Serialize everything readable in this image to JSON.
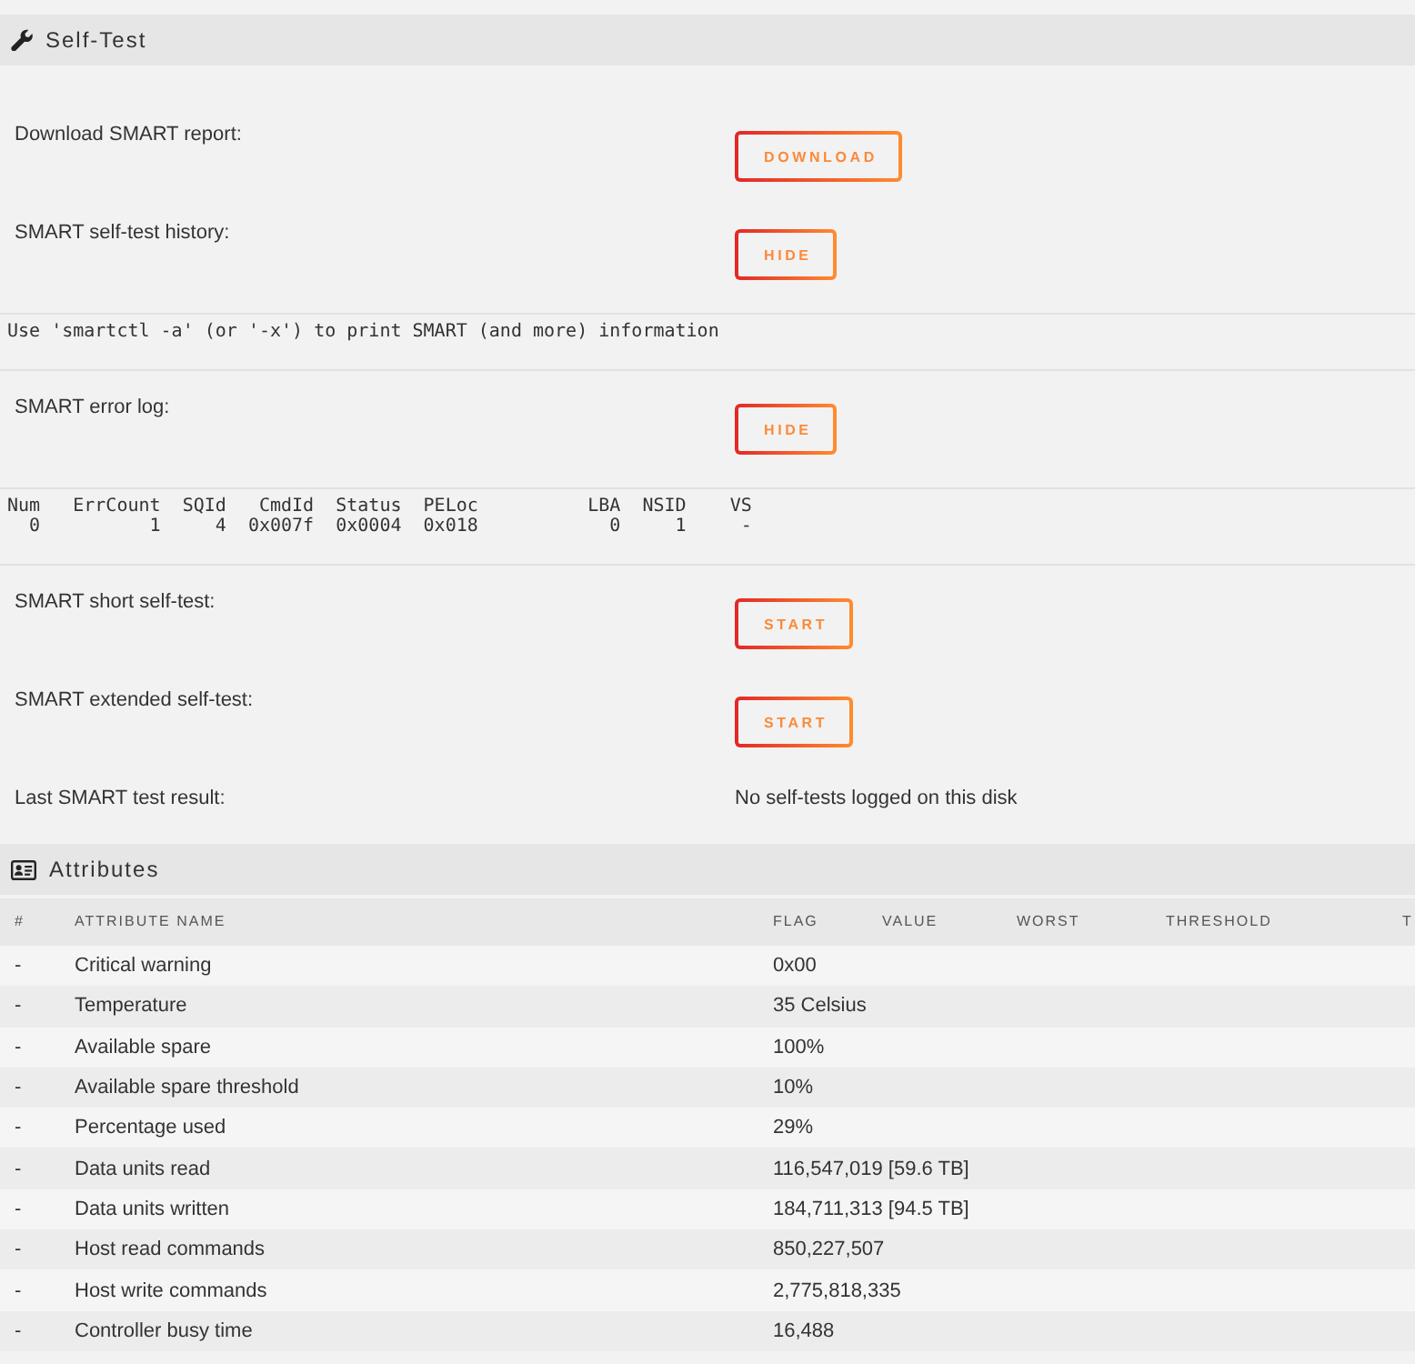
{
  "self_test": {
    "title": "Self-Test",
    "groups": [
      {
        "rows": [
          {
            "kind": "button",
            "label": "Download SMART report:",
            "button": "DOWNLOAD"
          },
          {
            "kind": "button",
            "label": "SMART self-test history:",
            "button": "HIDE"
          }
        ],
        "output": [
          "Use 'smartctl -a' (or '-x') to print SMART (and more) information"
        ]
      },
      {
        "rows": [
          {
            "kind": "button",
            "label": "SMART error log:",
            "button": "HIDE"
          }
        ],
        "output": [
          "Num   ErrCount  SQId   CmdId  Status  PELoc          LBA  NSID    VS",
          "  0          1     4  0x007f  0x0004  0x018            0     1     -"
        ]
      },
      {
        "rows": [
          {
            "kind": "button",
            "label": "SMART short self-test:",
            "button": "START"
          },
          {
            "kind": "button",
            "label": "SMART extended self-test:",
            "button": "START"
          },
          {
            "kind": "text",
            "label": "Last SMART test result:",
            "value": "No self-tests logged on this disk"
          }
        ]
      }
    ]
  },
  "attributes": {
    "title": "Attributes",
    "columns": [
      "#",
      "ATTRIBUTE NAME",
      "FLAG",
      "VALUE",
      "WORST",
      "THRESHOLD",
      "T"
    ],
    "rows": [
      {
        "number": "-",
        "name": "Critical warning",
        "value": "0x00"
      },
      {
        "number": "-",
        "name": "Temperature",
        "value": "35 Celsius"
      },
      {
        "number": "-",
        "name": "Available spare",
        "value": "100%"
      },
      {
        "number": "-",
        "name": "Available spare threshold",
        "value": "10%"
      },
      {
        "number": "-",
        "name": "Percentage used",
        "value": "29%"
      },
      {
        "number": "-",
        "name": "Data units read",
        "value": "116,547,019 [59.6 TB]"
      },
      {
        "number": "-",
        "name": "Data units written",
        "value": "184,711,313 [94.5 TB]"
      },
      {
        "number": "-",
        "name": "Host read commands",
        "value": "850,227,507"
      },
      {
        "number": "-",
        "name": "Host write commands",
        "value": "2,775,818,335"
      },
      {
        "number": "-",
        "name": "Controller busy time",
        "value": "16,488"
      }
    ]
  }
}
